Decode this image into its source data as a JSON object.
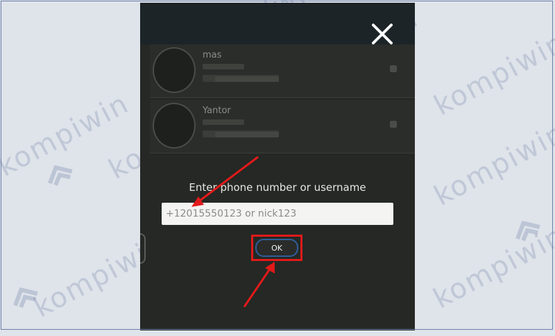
{
  "dialog": {
    "prompt": "Enter phone number or username",
    "input_value": "",
    "input_placeholder": "+12015550123 or nick123",
    "ok_label": "OK"
  },
  "contacts": [
    {
      "name": "mas"
    },
    {
      "name": "Yantor"
    }
  ],
  "watermark": {
    "text": "kompiwin",
    "color": "#6e82a5"
  },
  "annotations": {
    "color": "#e11a1a"
  },
  "icons": {
    "close": "close-icon"
  }
}
